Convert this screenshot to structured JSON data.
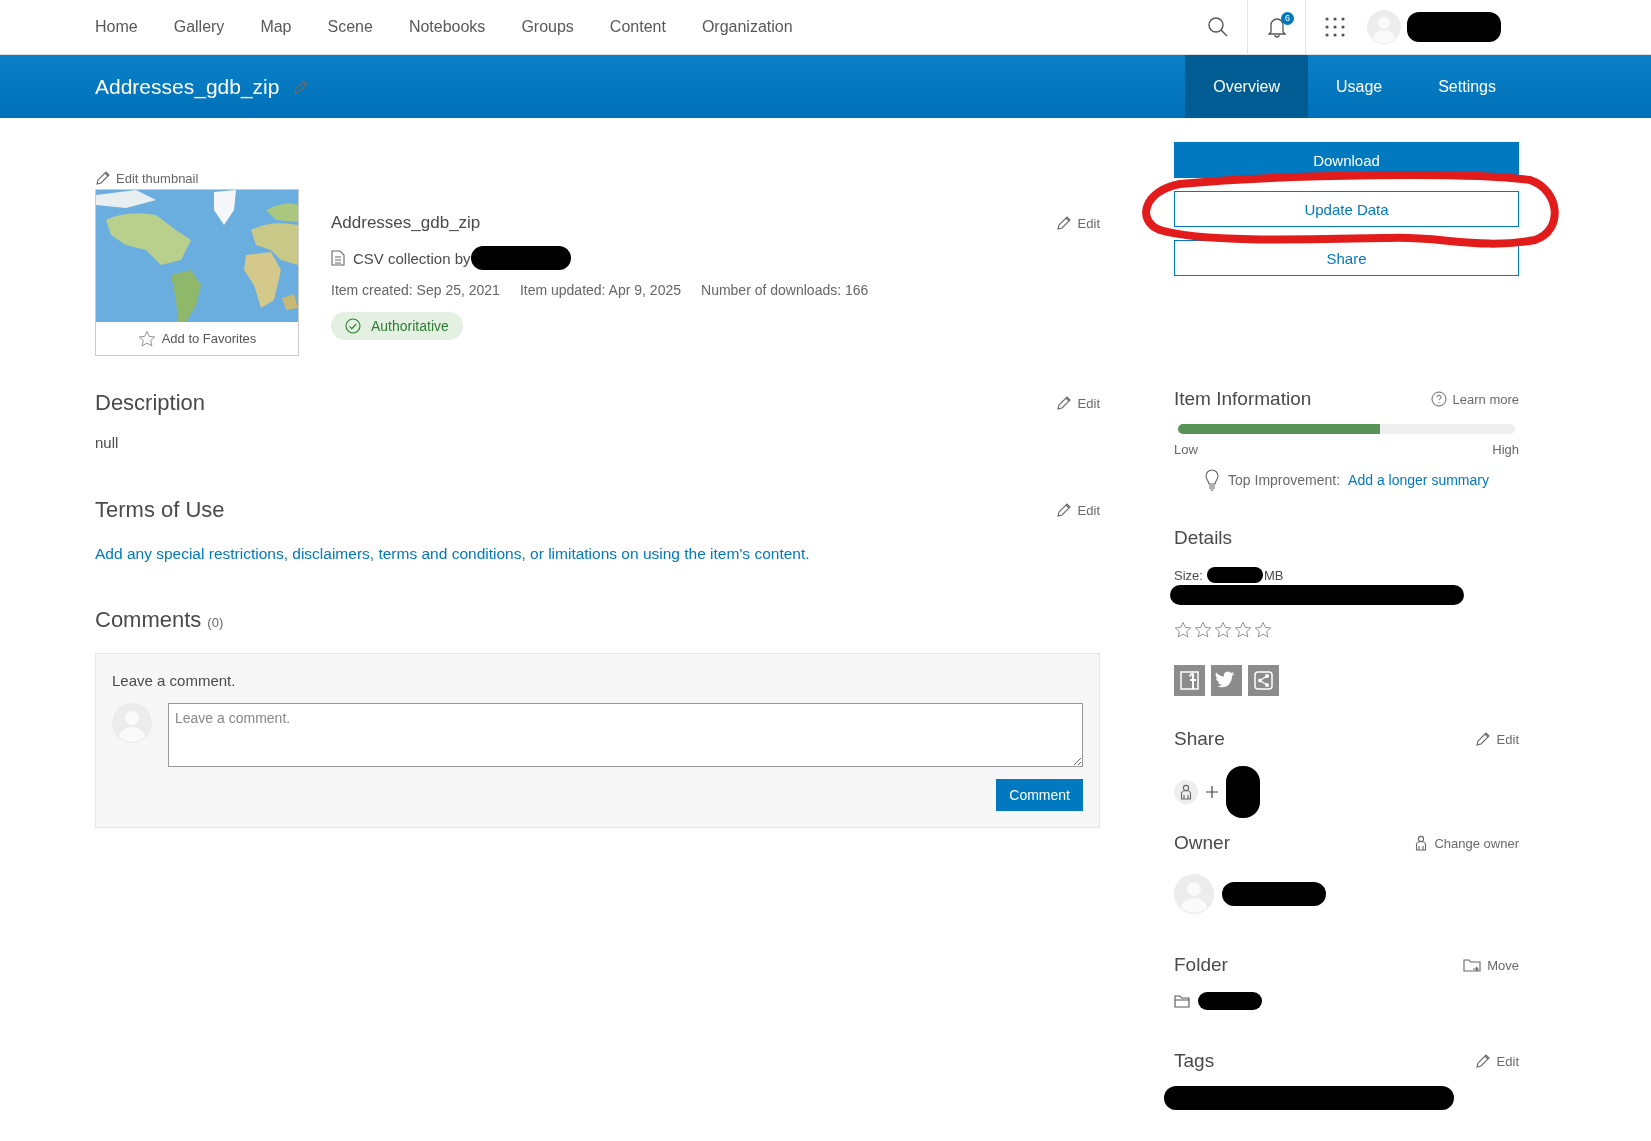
{
  "top_nav": {
    "items": [
      {
        "label": "Home",
        "selected": false
      },
      {
        "label": "Gallery",
        "selected": false
      },
      {
        "label": "Map",
        "selected": false
      },
      {
        "label": "Scene",
        "selected": false
      },
      {
        "label": "Notebooks",
        "selected": false
      },
      {
        "label": "Groups",
        "selected": false
      },
      {
        "label": "Content",
        "selected": false
      },
      {
        "label": "Organization",
        "selected": false
      }
    ],
    "notification_count": "6"
  },
  "header": {
    "title": "Addresses_gdb_zip",
    "tabs": [
      {
        "label": "Overview",
        "selected": true
      },
      {
        "label": "Usage",
        "selected": false
      },
      {
        "label": "Settings",
        "selected": false
      }
    ]
  },
  "item": {
    "edit_thumbnail": "Edit thumbnail",
    "favorites": "Add to Favorites",
    "title": "Addresses_gdb_zip",
    "type_line": "CSV collection by",
    "edit": "Edit",
    "meta": [
      "Item created: Sep 25, 2021",
      "Item updated: Apr 9, 2025",
      "Number of downloads: 166"
    ],
    "badge": "Authoritative"
  },
  "description": {
    "heading": "Description",
    "edit": "Edit",
    "text": "null"
  },
  "terms": {
    "heading": "Terms of Use",
    "edit": "Edit",
    "link": "Add any special restrictions, disclaimers, terms and conditions, or limitations on using the item's content."
  },
  "comments": {
    "heading": "Comments",
    "count": "(0)",
    "prompt": "Leave a comment.",
    "placeholder": "Leave a comment.",
    "button": "Comment"
  },
  "actions": [
    {
      "label": "Download",
      "kind": "primary"
    },
    {
      "label": "Update Data",
      "kind": "outline"
    },
    {
      "label": "Share",
      "kind": "outline"
    }
  ],
  "item_information": {
    "heading": "Item Information",
    "learn_more": "Learn more",
    "level": 0.6,
    "low": "Low",
    "high": "High",
    "top_improvement": "Top Improvement:",
    "suggestion": "Add a longer summary"
  },
  "details": {
    "heading": "Details",
    "size_label": "Size:",
    "size_unit": "MB",
    "stars": 0
  },
  "share": {
    "heading": "Share",
    "edit": "Edit"
  },
  "owner": {
    "heading": "Owner",
    "action": "Change owner"
  },
  "folder": {
    "heading": "Folder",
    "action": "Move"
  },
  "tags": {
    "heading": "Tags",
    "edit": "Edit"
  }
}
